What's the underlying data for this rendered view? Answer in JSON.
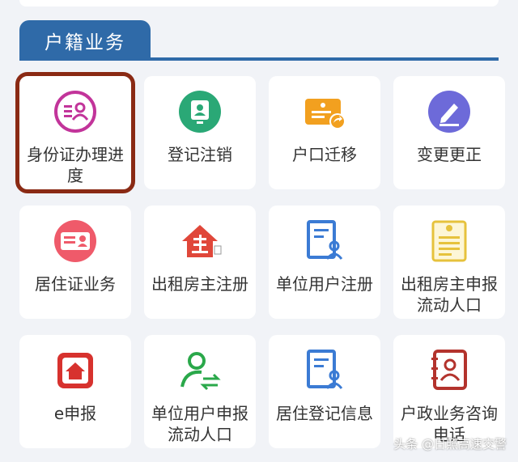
{
  "section": {
    "title": "户籍业务"
  },
  "tiles": [
    {
      "label": "身份证办理进度",
      "icon": "id-card-user-icon"
    },
    {
      "label": "登记注销",
      "icon": "id-badge-icon"
    },
    {
      "label": "户口迁移",
      "icon": "transfer-certificate-icon"
    },
    {
      "label": "变更更正",
      "icon": "edit-pencil-icon"
    },
    {
      "label": "居住证业务",
      "icon": "residence-card-icon"
    },
    {
      "label": "出租房主注册",
      "icon": "house-owner-icon"
    },
    {
      "label": "单位用户注册",
      "icon": "document-user-icon"
    },
    {
      "label": "出租房主申报流动人口",
      "icon": "notice-document-icon"
    },
    {
      "label": "e申报",
      "icon": "home-report-icon"
    },
    {
      "label": "单位用户申报流动人口",
      "icon": "user-exchange-icon"
    },
    {
      "label": "居住登记信息",
      "icon": "document-user-icon"
    },
    {
      "label": "户政业务咨询电话",
      "icon": "phone-contact-icon"
    }
  ],
  "watermark": "头条 @日照高速交警",
  "colors": {
    "accent": "#2f6aa8",
    "highlight": "#8a2a14"
  }
}
